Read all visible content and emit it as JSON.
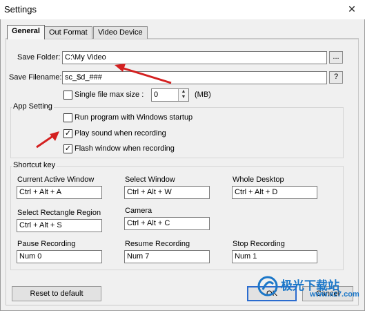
{
  "window": {
    "title": "Settings",
    "close_glyph": "✕"
  },
  "tabs": [
    {
      "label": "General",
      "active": true
    },
    {
      "label": "Out Format",
      "active": false
    },
    {
      "label": "Video Device",
      "active": false
    }
  ],
  "save_folder": {
    "label": "Save Folder:",
    "value": "C:\\My Video",
    "browse_label": "..."
  },
  "save_filename": {
    "label": "Save Filename:",
    "value": "sc_$d_###",
    "help_label": "?"
  },
  "single_file": {
    "label": "Single file max size :",
    "checked": false,
    "value": "0",
    "unit": "(MB)"
  },
  "app_setting": {
    "title": "App Setting",
    "options": [
      {
        "label": "Run program with Windows startup",
        "checked": false
      },
      {
        "label": "Play sound when recording",
        "checked": true
      },
      {
        "label": "Flash window when recording",
        "checked": true
      }
    ]
  },
  "shortcut": {
    "title": "Shortcut key",
    "items": [
      {
        "label": "Current Active Window",
        "value": "Ctrl + Alt + A"
      },
      {
        "label": "Select Window",
        "value": "Ctrl + Alt + W"
      },
      {
        "label": "Whole Desktop",
        "value": "Ctrl + Alt + D"
      },
      {
        "label": "Select Rectangle Region",
        "value": "Ctrl + Alt + S"
      },
      {
        "label": "Camera",
        "value": "Ctrl + Alt + C"
      },
      {
        "label": "Pause Recording",
        "value": "Num 0"
      },
      {
        "label": "Resume Recording",
        "value": "Num 7"
      },
      {
        "label": "Stop Recording",
        "value": "Num 1"
      }
    ]
  },
  "buttons": {
    "reset": "Reset to default",
    "ok": "OK",
    "cancel": "Cancel"
  },
  "watermark": {
    "title": "极光下载站",
    "url": "www.xz7.com"
  },
  "colors": {
    "arrow": "#d42020",
    "accent": "#2b6ccf",
    "watermark": "#1c77c8"
  }
}
